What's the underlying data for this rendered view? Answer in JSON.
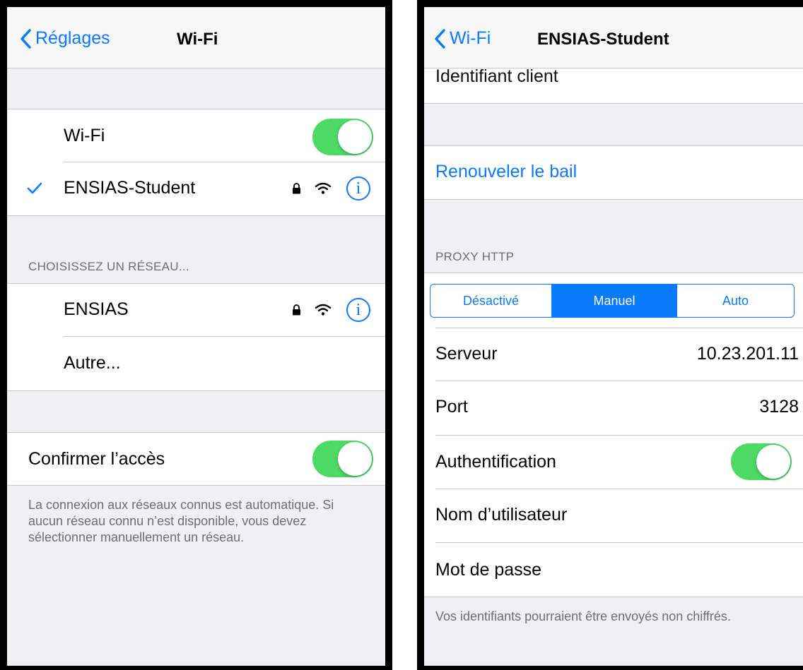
{
  "left": {
    "nav": {
      "back_label": "Réglages",
      "title": "Wi-Fi"
    },
    "wifi_row": {
      "label": "Wi-Fi",
      "enabled": true
    },
    "connected_network": {
      "name": "ENSIAS-Student",
      "checked": true,
      "secured": true
    },
    "section_header": "CHOISISSEZ UN RÉSEAU...",
    "networks": [
      {
        "name": "ENSIAS",
        "secured": true
      },
      {
        "name": "Autre...",
        "secured": false
      }
    ],
    "confirm_access": {
      "label": "Confirmer l’accès",
      "enabled": true
    },
    "footer": "La connexion aux réseaux connus est automatique. Si aucun réseau connu n’est disponible, vous devez sélectionner manuellement un réseau.",
    "info_glyph": "i"
  },
  "right": {
    "nav": {
      "back_label": "Wi-Fi",
      "title": "ENSIAS-Student"
    },
    "partial_row": "Identifiant client",
    "renew_lease": "Renouveler le bail",
    "proxy_header": "PROXY HTTP",
    "proxy_modes": [
      "Désactivé",
      "Manuel",
      "Auto"
    ],
    "proxy_selected": "Manuel",
    "server": {
      "label": "Serveur",
      "value": "10.23.201.11"
    },
    "port": {
      "label": "Port",
      "value": "3128"
    },
    "authentication": {
      "label": "Authentification",
      "enabled": true
    },
    "username": {
      "label": "Nom d’utilisateur",
      "value": ""
    },
    "password": {
      "label": "Mot de passe",
      "value": ""
    },
    "footer": "Vos identifiants pourraient être envoyés non chiffrés."
  },
  "colors": {
    "accent": "#0a7aff",
    "toggle_on": "#4cd964",
    "background": "#efeff4",
    "separator": "#c8c7cc"
  }
}
